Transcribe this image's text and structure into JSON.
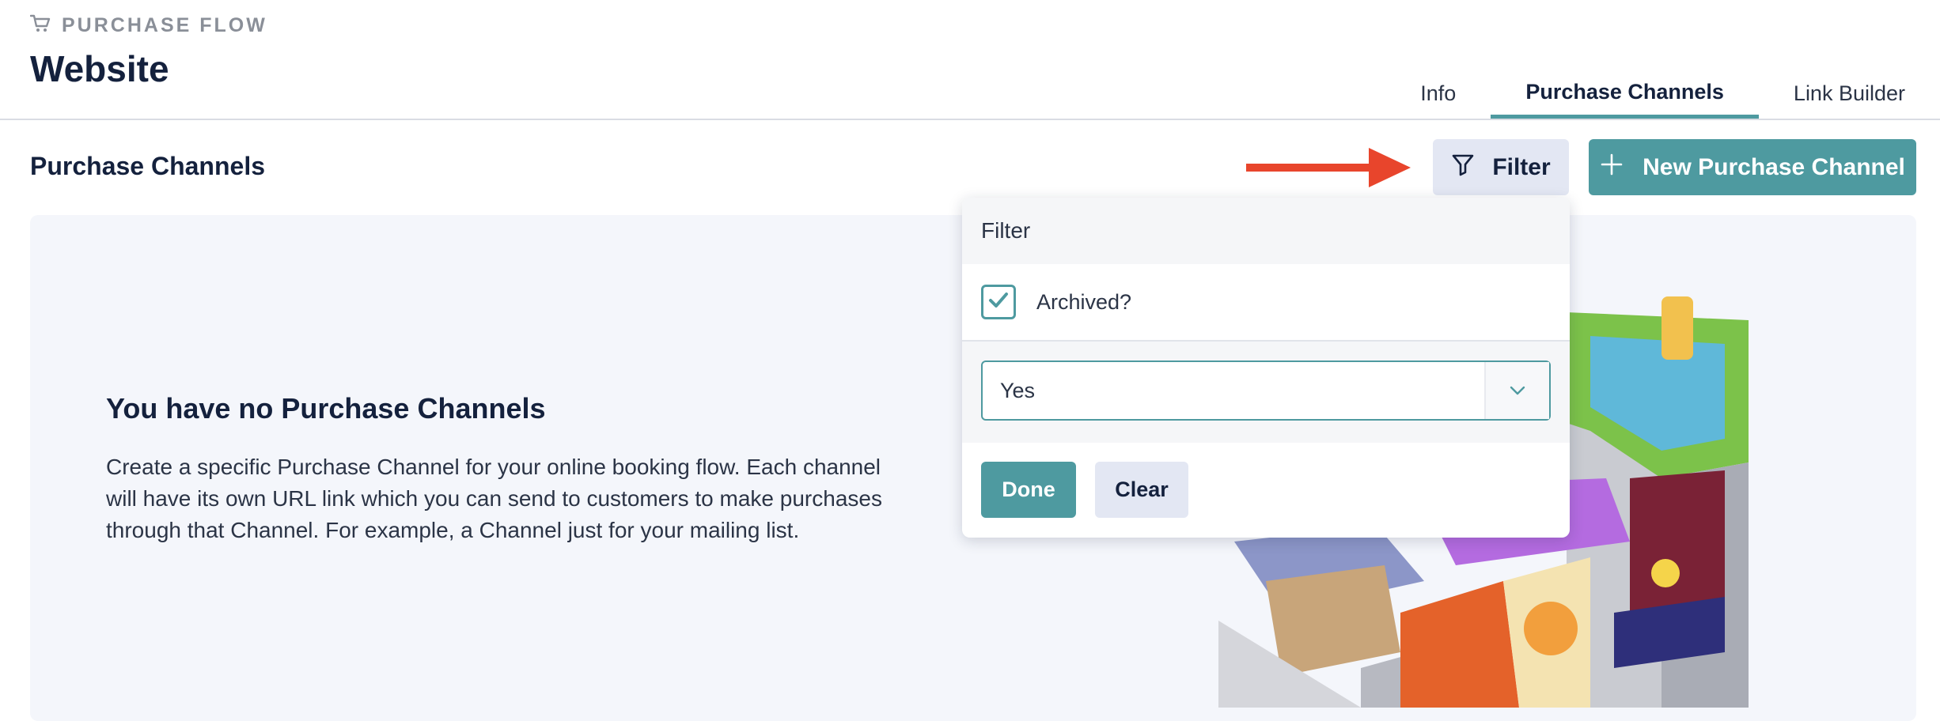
{
  "header": {
    "eyebrow": "PURCHASE FLOW",
    "eyebrow_icon": "cart-icon",
    "title": "Website",
    "tabs": [
      {
        "label": "Info",
        "active": false
      },
      {
        "label": "Purchase Channels",
        "active": true
      },
      {
        "label": "Link Builder",
        "active": false
      }
    ]
  },
  "section": {
    "title": "Purchase Channels"
  },
  "toolbar": {
    "filter_label": "Filter",
    "filter_icon": "funnel-icon",
    "new_label": "New Purchase Channel",
    "new_icon": "plus-icon"
  },
  "empty_state": {
    "title": "You have no Purchase Channels",
    "description": "Create a specific Purchase Channel for your online booking flow. Each channel will have its own URL link which you can send to customers to make purchases through that Channel. For example, a Channel just for your mailing list."
  },
  "filter_dropdown": {
    "heading": "Filter",
    "archived_label": "Archived?",
    "archived_checked": true,
    "select_value": "Yes",
    "done_label": "Done",
    "clear_label": "Clear"
  },
  "colors": {
    "accent": "#4e9aa0",
    "navy": "#14213d",
    "arrow": "#e8452c",
    "panel_bg": "#f4f6fb",
    "secondary_btn": "#e3e7f3"
  }
}
